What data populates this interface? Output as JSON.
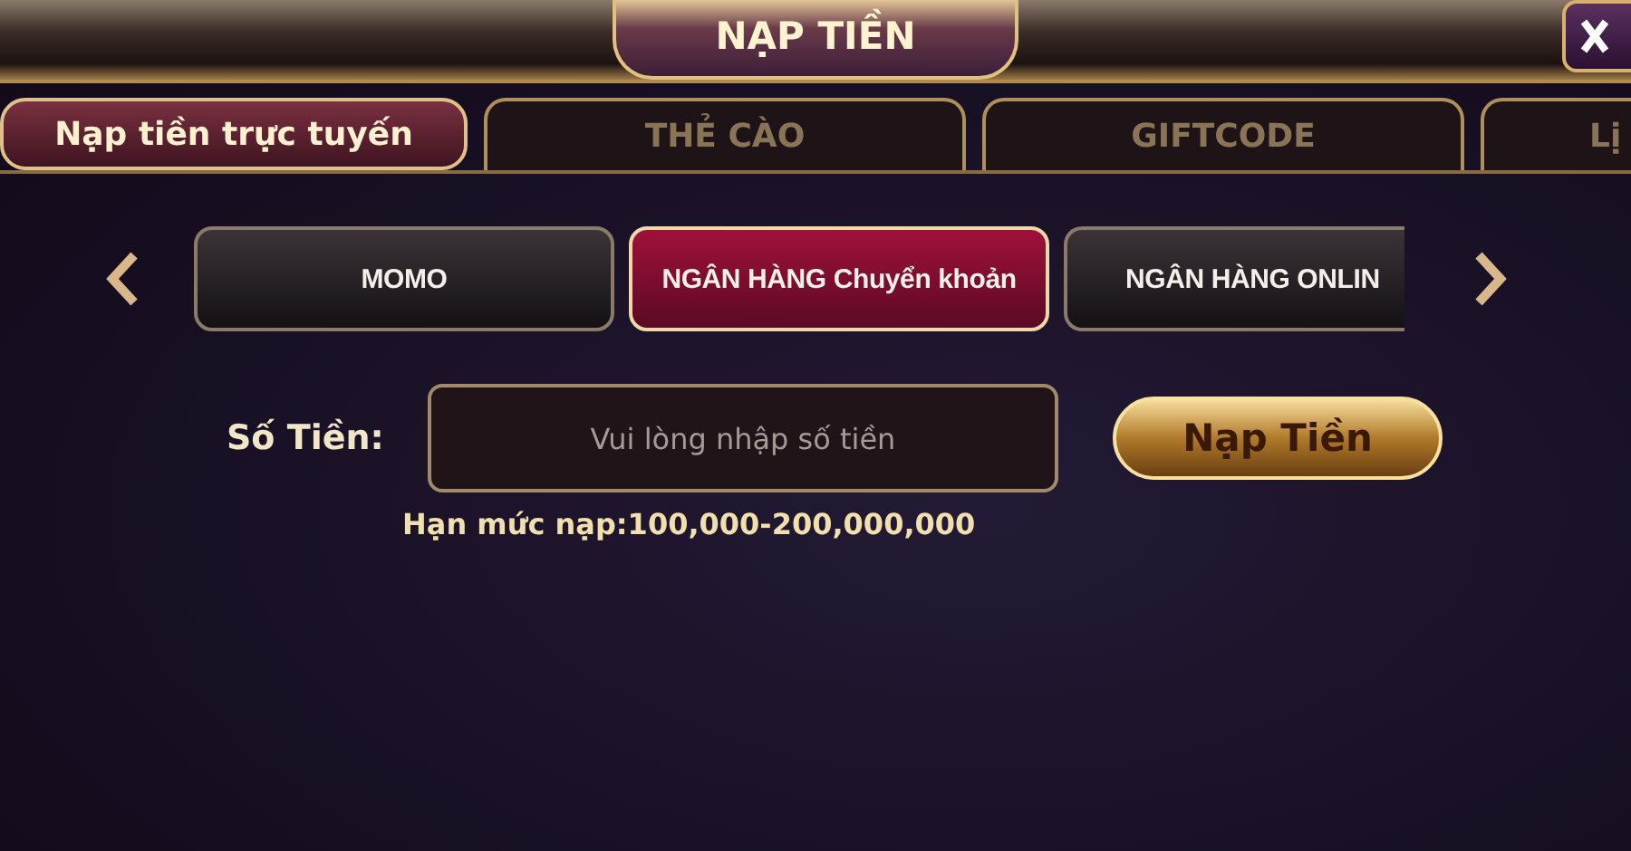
{
  "window": {
    "title": "NẠP TIỀN"
  },
  "tabs": [
    {
      "label": "Nạp tiền trực tuyến",
      "selected": true
    },
    {
      "label": "THẺ CÀO",
      "selected": false
    },
    {
      "label": "GIFTCODE",
      "selected": false
    },
    {
      "label": "Lị",
      "selected": false
    }
  ],
  "methods": [
    {
      "label": "MOMO",
      "selected": false
    },
    {
      "label": "NGÂN HÀNG Chuyển khoản",
      "selected": true
    },
    {
      "label": "NGÂN HÀNG ONLIN",
      "selected": false
    }
  ],
  "amount": {
    "label": "Số Tiền:",
    "placeholder": "Vui lòng nhập số tiền"
  },
  "submit_button": "Nạp Tiền",
  "limit": "Hạn mức nạp:100,000-200,000,000"
}
